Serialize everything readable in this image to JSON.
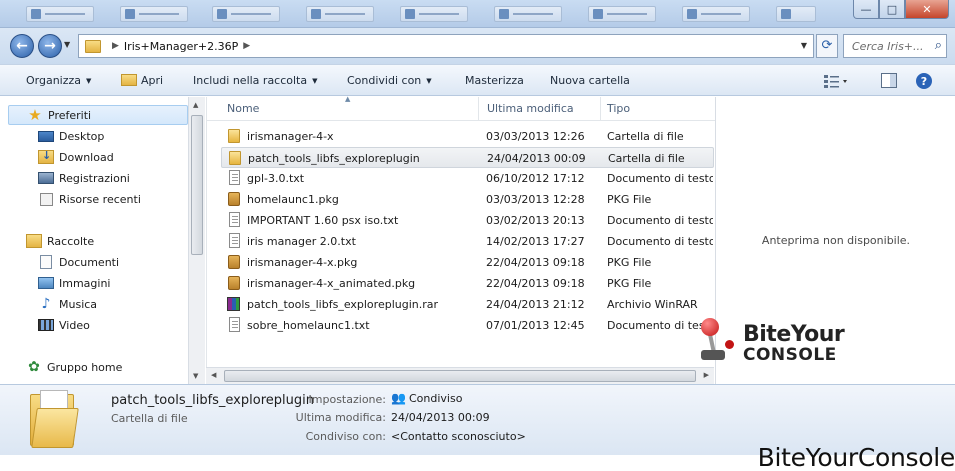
{
  "window": {
    "controls": {
      "minimize": "—",
      "maximize": "□",
      "close": "✕"
    }
  },
  "address_bar": {
    "breadcrumb": [
      "Iris+Manager+2.36P"
    ],
    "search_placeholder": "Cerca Iris+..."
  },
  "toolbar": {
    "organize": "Organizza",
    "open": "Apri",
    "include": "Includi nella raccolta",
    "share": "Condividi con",
    "burn": "Masterizza",
    "new_folder": "Nuova cartella"
  },
  "navigation": {
    "favorites": {
      "label": "Preferiti",
      "items": [
        "Desktop",
        "Download",
        "Registrazioni",
        "Risorse recenti"
      ]
    },
    "libraries": {
      "label": "Raccolte",
      "items": [
        "Documenti",
        "Immagini",
        "Musica",
        "Video"
      ]
    },
    "homegroup": "Gruppo home"
  },
  "columns": {
    "name": "Nome",
    "modified": "Ultima modifica",
    "type": "Tipo"
  },
  "files": [
    {
      "name": "irismanager-4-x",
      "modified": "03/03/2013 12:26",
      "type": "Cartella di file",
      "icon": "folder-icon"
    },
    {
      "name": "patch_tools_libfs_exploreplugin",
      "modified": "24/04/2013 00:09",
      "type": "Cartella di file",
      "icon": "folder-icon"
    },
    {
      "name": "gpl-3.0.txt",
      "modified": "06/10/2012 17:12",
      "type": "Documento di testo",
      "icon": "text-file-icon"
    },
    {
      "name": "homelaunc1.pkg",
      "modified": "03/03/2013 12:28",
      "type": "PKG File",
      "icon": "package-icon"
    },
    {
      "name": "IMPORTANT 1.60 psx iso.txt",
      "modified": "03/02/2013 20:13",
      "type": "Documento di testo",
      "icon": "text-file-icon"
    },
    {
      "name": "iris manager 2.0.txt",
      "modified": "14/02/2013 17:27",
      "type": "Documento di testo",
      "icon": "text-file-icon"
    },
    {
      "name": "irismanager-4-x.pkg",
      "modified": "22/04/2013 09:18",
      "type": "PKG File",
      "icon": "package-icon"
    },
    {
      "name": "irismanager-4-x_animated.pkg",
      "modified": "22/04/2013 09:18",
      "type": "PKG File",
      "icon": "package-icon"
    },
    {
      "name": "patch_tools_libfs_exploreplugin.rar",
      "modified": "24/04/2013 21:12",
      "type": "Archivio WinRAR",
      "icon": "winrar-archive-icon"
    },
    {
      "name": "sobre_homelaunc1.txt",
      "modified": "07/01/2013 12:45",
      "type": "Documento di testo",
      "icon": "text-file-icon"
    }
  ],
  "preview": {
    "message": "Anteprima non disponibile.",
    "logo_line1": "BiteYour",
    "logo_line2": "CONSOLE"
  },
  "details": {
    "name": "patch_tools_libfs_exploreplugin",
    "type": "Cartella di file",
    "setting_label": "Impostazione:",
    "setting_value": "Condiviso",
    "modified_label": "Ultima modifica:",
    "modified_value": "24/04/2013 00:09",
    "shared_label": "Condiviso con:",
    "shared_value": "<Contatto sconosciuto>"
  },
  "watermark": "BiteYourConsole"
}
